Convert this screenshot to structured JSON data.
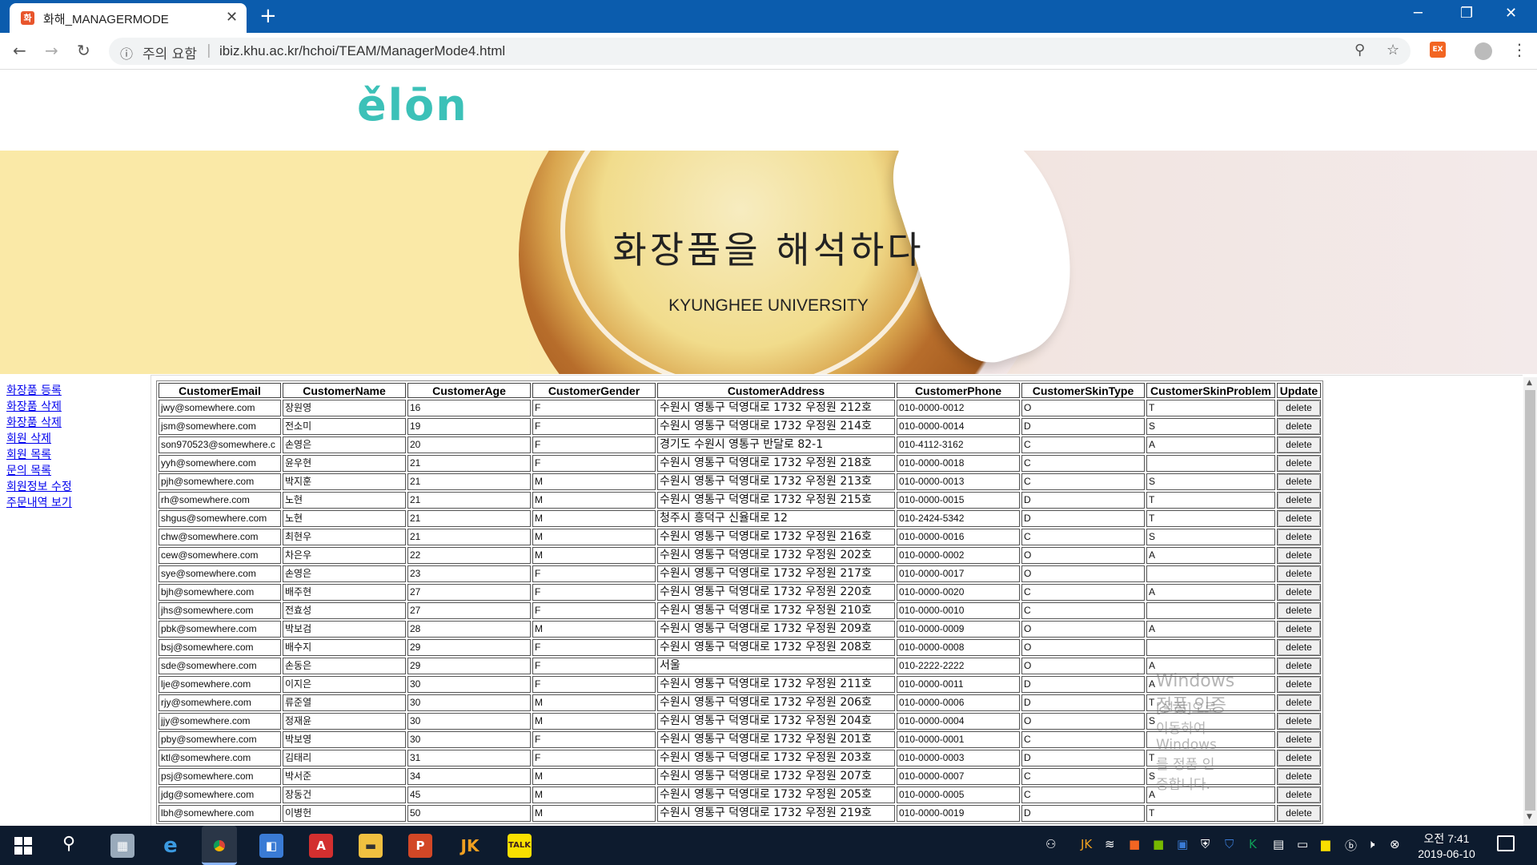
{
  "browser": {
    "tab_title": "화해_MANAGERMODE",
    "tab_favicon": "화",
    "tab_close": "✕",
    "new_tab": "+",
    "security_label": "주의 요함",
    "url": "ibiz.khu.ac.kr/hchoi/TEAM/ManagerMode4.html",
    "ext_label": "EX"
  },
  "page": {
    "logo": "ělōn",
    "banner_title": "화장품을 해석하다",
    "banner_subtitle": "KYUNGHEE UNIVERSITY"
  },
  "menu": [
    "화장품 등록",
    "화장품 삭제",
    "화장품 삭제",
    "회원 삭제",
    "회원 목록",
    "문의 목록",
    "회원정보 수정",
    "주문내역 보기"
  ],
  "table": {
    "headers": [
      "CustomerEmail",
      "CustomerName",
      "CustomerAge",
      "CustomerGender",
      "CustomerAddress",
      "CustomerPhone",
      "CustomerSkinType",
      "CustomerSkinProblem",
      "Update"
    ],
    "button_label": "delete",
    "rows": [
      [
        "jwy@somewhere.com",
        "장원영",
        "16",
        "F",
        "수원시 영통구 덕영대로 1732 우정원 212호",
        "010-0000-0012",
        "O",
        "T"
      ],
      [
        "jsm@somewhere.com",
        "전소미",
        "19",
        "F",
        "수원시 영통구 덕영대로 1732 우정원 214호",
        "010-0000-0014",
        "D",
        "S"
      ],
      [
        "son970523@somewhere.c",
        "손영은",
        "20",
        "F",
        "경기도 수원시 영통구 반달로 82-1",
        "010-4112-3162",
        "C",
        "A"
      ],
      [
        "yyh@somewhere.com",
        "윤우현",
        "21",
        "F",
        "수원시 영통구 덕영대로 1732 우정원 218호",
        "010-0000-0018",
        "C",
        ""
      ],
      [
        "pjh@somewhere.com",
        "박지훈",
        "21",
        "M",
        "수원시 영통구 덕영대로 1732 우정원 213호",
        "010-0000-0013",
        "C",
        "S"
      ],
      [
        "rh@somewhere.com",
        "노현",
        "21",
        "M",
        "수원시 영통구 덕영대로 1732 우정원 215호",
        "010-0000-0015",
        "D",
        "T"
      ],
      [
        "shgus@somewhere.com",
        "노현",
        "21",
        "M",
        "청주시 흥덕구 신율대로 12",
        "010-2424-5342",
        "D",
        "T"
      ],
      [
        "chw@somewhere.com",
        "최현우",
        "21",
        "M",
        "수원시 영통구 덕영대로 1732 우정원 216호",
        "010-0000-0016",
        "C",
        "S"
      ],
      [
        "cew@somewhere.com",
        "차은우",
        "22",
        "M",
        "수원시 영통구 덕영대로 1732 우정원 202호",
        "010-0000-0002",
        "O",
        "A"
      ],
      [
        "sye@somewhere.com",
        "손영은",
        "23",
        "F",
        "수원시 영통구 덕영대로 1732 우정원 217호",
        "010-0000-0017",
        "O",
        ""
      ],
      [
        "bjh@somewhere.com",
        "배주현",
        "27",
        "F",
        "수원시 영통구 덕영대로 1732 우정원 220호",
        "010-0000-0020",
        "C",
        "A"
      ],
      [
        "jhs@somewhere.com",
        "전효성",
        "27",
        "F",
        "수원시 영통구 덕영대로 1732 우정원 210호",
        "010-0000-0010",
        "C",
        ""
      ],
      [
        "pbk@somewhere.com",
        "박보검",
        "28",
        "M",
        "수원시 영통구 덕영대로 1732 우정원 209호",
        "010-0000-0009",
        "O",
        "A"
      ],
      [
        "bsj@somewhere.com",
        "배수지",
        "29",
        "F",
        "수원시 영통구 덕영대로 1732 우정원 208호",
        "010-0000-0008",
        "O",
        ""
      ],
      [
        "sde@somewhere.com",
        "손동은",
        "29",
        "F",
        "서울",
        "010-2222-2222",
        "O",
        "A"
      ],
      [
        "lje@somewhere.com",
        "이지은",
        "30",
        "F",
        "수원시 영통구 덕영대로 1732 우정원 211호",
        "010-0000-0011",
        "D",
        "A"
      ],
      [
        "rjy@somewhere.com",
        "류준열",
        "30",
        "M",
        "수원시 영통구 덕영대로 1732 우정원 206호",
        "010-0000-0006",
        "D",
        "T"
      ],
      [
        "jjy@somewhere.com",
        "정재윤",
        "30",
        "M",
        "수원시 영통구 덕영대로 1732 우정원 204호",
        "010-0000-0004",
        "O",
        "S"
      ],
      [
        "pby@somewhere.com",
        "박보영",
        "30",
        "F",
        "수원시 영통구 덕영대로 1732 우정원 201호",
        "010-0000-0001",
        "C",
        ""
      ],
      [
        "ktl@somewhere.com",
        "김태리",
        "31",
        "F",
        "수원시 영통구 덕영대로 1732 우정원 203호",
        "010-0000-0003",
        "D",
        "T"
      ],
      [
        "psj@somewhere.com",
        "박서준",
        "34",
        "M",
        "수원시 영통구 덕영대로 1732 우정원 207호",
        "010-0000-0007",
        "C",
        "S"
      ],
      [
        "jdg@somewhere.com",
        "장동건",
        "45",
        "M",
        "수원시 영통구 덕영대로 1732 우정원 205호",
        "010-0000-0005",
        "C",
        "A"
      ],
      [
        "lbh@somewhere.com",
        "이병헌",
        "50",
        "M",
        "수원시 영통구 덕영대로 1732 우정원 219호",
        "010-0000-0019",
        "D",
        "T"
      ]
    ]
  },
  "watermark": {
    "line1": "Windows 정품 인증",
    "line2": "[설정]으로 이동하여 Windows를 정품 인증합니다."
  },
  "taskbar": {
    "time": "오전 7:41",
    "date": "2019-06-10",
    "apps": [
      "file-manager-icon",
      "ie-icon",
      "chrome-icon",
      "app-icon",
      "acrobat-icon",
      "explorer-icon",
      "powerpoint-icon",
      "jk-icon",
      "kakaotalk-icon"
    ]
  }
}
